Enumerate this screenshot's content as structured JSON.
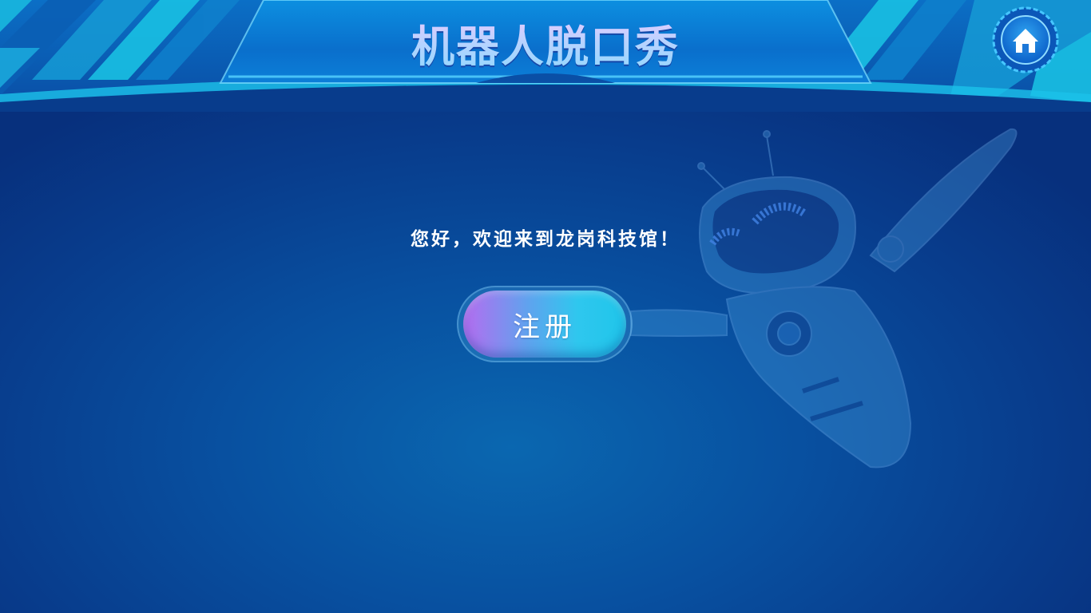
{
  "header": {
    "title": "机器人脱口秀",
    "home_icon": "home-icon"
  },
  "main": {
    "welcome_message": "您好，欢迎来到龙岗科技馆！",
    "register_button_label": "注册"
  },
  "decoration": {
    "robot_image": "robot-illustration"
  },
  "colors": {
    "background": "#083c8c",
    "header_band": "#0a7fd0",
    "accent_cyan": "#2fc7ee",
    "accent_purple": "#b66cf0"
  }
}
